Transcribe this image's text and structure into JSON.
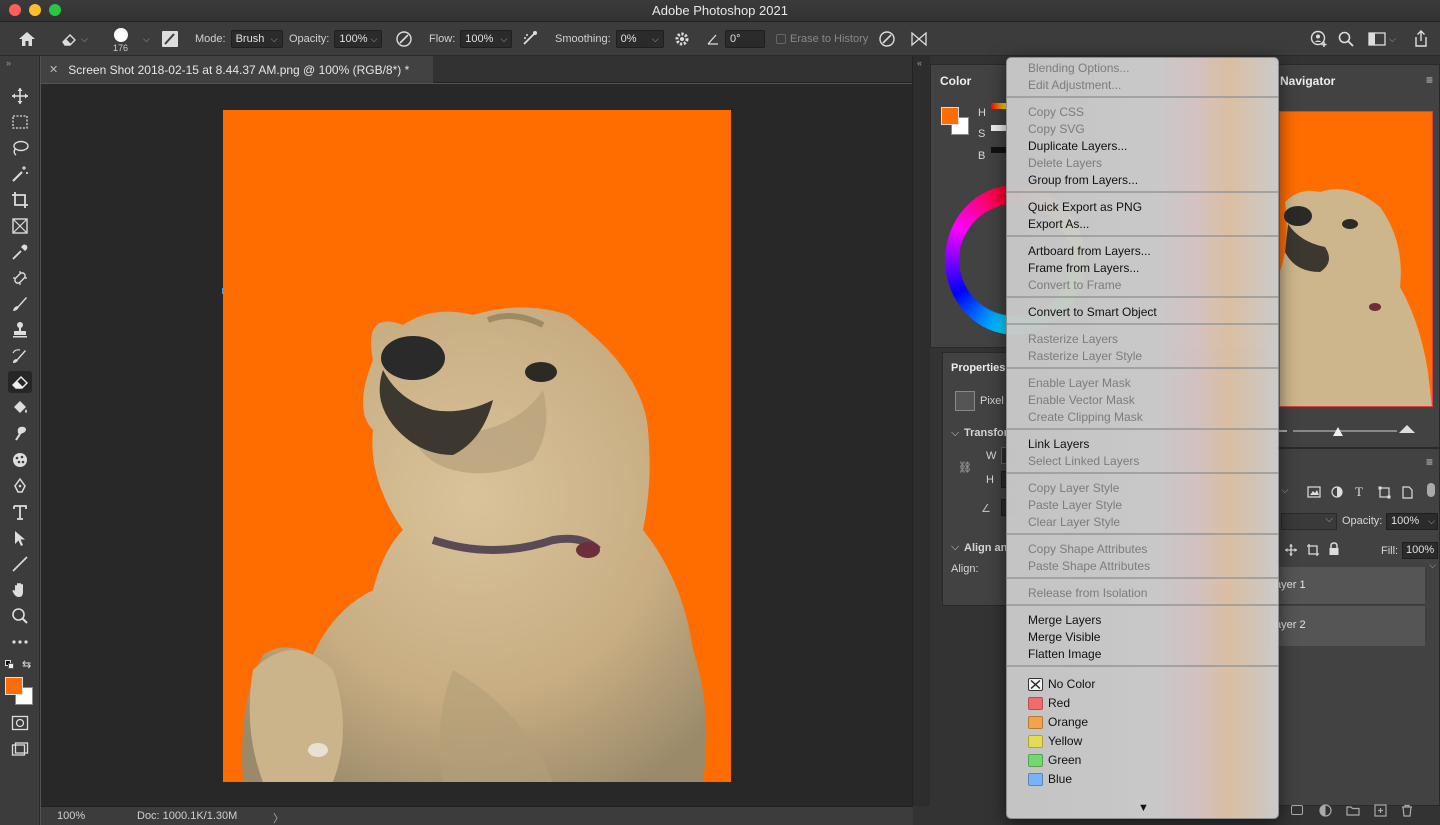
{
  "window": {
    "title": "Adobe Photoshop 2021"
  },
  "options_bar": {
    "brush_size": "176",
    "mode_label": "Mode:",
    "mode_value": "Brush",
    "opacity_label": "Opacity:",
    "opacity_value": "100%",
    "flow_label": "Flow:",
    "flow_value": "100%",
    "smoothing_label": "Smoothing:",
    "smoothing_value": "0%",
    "angle_value": "0°",
    "erase_to_history": "Erase to History"
  },
  "document": {
    "tab_title": "Screen Shot 2018-02-15 at 8.44.37 AM.png @ 100% (RGB/8*) *",
    "zoom": "100%",
    "doc_info": "Doc: 1000.1K/1.30M",
    "background_color": "#ff6d00"
  },
  "panels": {
    "color_tab": "Color",
    "color_labels": [
      "H",
      "S",
      "B"
    ],
    "navigator_tab": "Navigator",
    "properties_tab": "Properties",
    "pixel_label": "Pixel",
    "transform_label": "Transfor",
    "w_label": "W",
    "h_label": "H",
    "align_section": "Align an",
    "align_label": "Align:",
    "opacity_label": "Opacity:",
    "opacity_value": "100%",
    "fill_label": "Fill:",
    "fill_value": "100%",
    "layers": [
      "ayer 1",
      "ayer 2"
    ]
  },
  "context_menu": {
    "groups": [
      [
        {
          "label": "Blending Options...",
          "enabled": false
        },
        {
          "label": "Edit Adjustment...",
          "enabled": false
        }
      ],
      [
        {
          "label": "Copy CSS",
          "enabled": false
        },
        {
          "label": "Copy SVG",
          "enabled": false
        },
        {
          "label": "Duplicate Layers...",
          "enabled": true
        },
        {
          "label": "Delete Layers",
          "enabled": false
        },
        {
          "label": "Group from Layers...",
          "enabled": true
        }
      ],
      [
        {
          "label": "Quick Export as PNG",
          "enabled": true
        },
        {
          "label": "Export As...",
          "enabled": true
        }
      ],
      [
        {
          "label": "Artboard from Layers...",
          "enabled": true
        },
        {
          "label": "Frame from Layers...",
          "enabled": true
        },
        {
          "label": "Convert to Frame",
          "enabled": false
        }
      ],
      [
        {
          "label": "Convert to Smart Object",
          "enabled": true
        }
      ],
      [
        {
          "label": "Rasterize Layers",
          "enabled": false
        },
        {
          "label": "Rasterize Layer Style",
          "enabled": false
        }
      ],
      [
        {
          "label": "Enable Layer Mask",
          "enabled": false
        },
        {
          "label": "Enable Vector Mask",
          "enabled": false
        },
        {
          "label": "Create Clipping Mask",
          "enabled": false
        }
      ],
      [
        {
          "label": "Link Layers",
          "enabled": true
        },
        {
          "label": "Select Linked Layers",
          "enabled": false
        }
      ],
      [
        {
          "label": "Copy Layer Style",
          "enabled": false
        },
        {
          "label": "Paste Layer Style",
          "enabled": false
        },
        {
          "label": "Clear Layer Style",
          "enabled": false
        }
      ],
      [
        {
          "label": "Copy Shape Attributes",
          "enabled": false
        },
        {
          "label": "Paste Shape Attributes",
          "enabled": false
        }
      ],
      [
        {
          "label": "Release from Isolation",
          "enabled": false
        }
      ],
      [
        {
          "label": "Merge Layers",
          "enabled": true
        },
        {
          "label": "Merge Visible",
          "enabled": true
        },
        {
          "label": "Flatten Image",
          "enabled": true
        }
      ]
    ],
    "colors": [
      {
        "label": "No Color",
        "swatch": "none"
      },
      {
        "label": "Red",
        "swatch": "#f06b6b"
      },
      {
        "label": "Orange",
        "swatch": "#f5a24a"
      },
      {
        "label": "Yellow",
        "swatch": "#e4dc53"
      },
      {
        "label": "Green",
        "swatch": "#75d86f"
      },
      {
        "label": "Blue",
        "swatch": "#7ab3f5"
      }
    ],
    "scroll_arrow": "▼"
  },
  "colors": {
    "foreground": "#ff6d00",
    "background": "#ffffff",
    "accent": "#1f6fd6"
  }
}
